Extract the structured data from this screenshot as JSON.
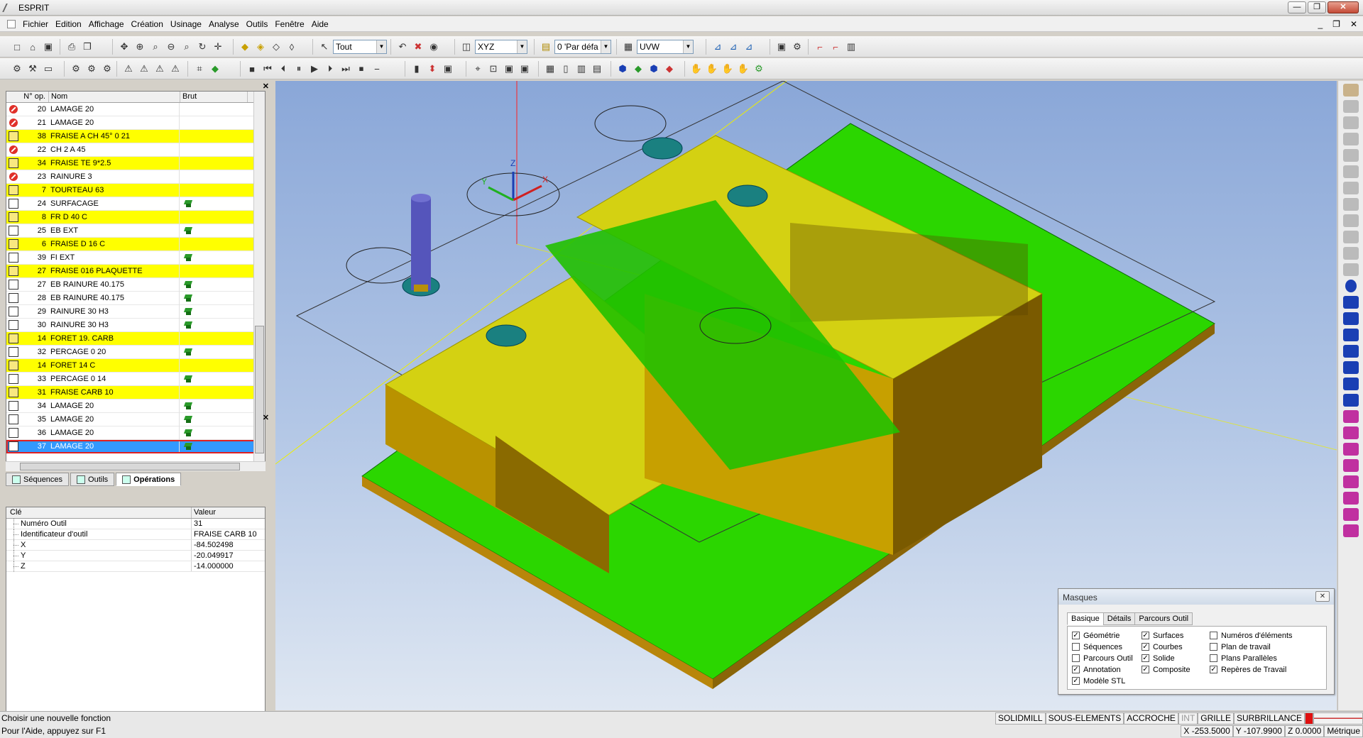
{
  "title": "ESPRIT",
  "window_buttons": {
    "minimize": "—",
    "restore": "❐",
    "close": "✕"
  },
  "menu": [
    "Fichier",
    "Edition",
    "Affichage",
    "Création",
    "Usinage",
    "Analyse",
    "Outils",
    "Fenêtre",
    "Aide"
  ],
  "mdi_buttons": {
    "minimize": "_",
    "restore": "❐",
    "close": "✕"
  },
  "toolbar": {
    "select_filter": "Tout",
    "plane": "XYZ",
    "layer": "0 'Par défa",
    "work_plane": "UVW"
  },
  "operations": {
    "headers": {
      "num": "N° op.",
      "name": "Nom",
      "brut": "Brut"
    },
    "rows": [
      {
        "icon": "forbid",
        "num": "20",
        "name": "LAMAGE 20",
        "brut": false,
        "style": "normal"
      },
      {
        "icon": "forbid",
        "num": "21",
        "name": "LAMAGE 20",
        "brut": false,
        "style": "normal"
      },
      {
        "icon": "tool",
        "num": "38",
        "name": "FRAISE A CH 45° 0 21",
        "brut": false,
        "style": "yellow"
      },
      {
        "icon": "forbid",
        "num": "22",
        "name": "CH 2 A 45",
        "brut": false,
        "style": "normal"
      },
      {
        "icon": "tool",
        "num": "34",
        "name": "FRAISE TE 9*2.5",
        "brut": false,
        "style": "yellow"
      },
      {
        "icon": "forbid",
        "num": "23",
        "name": "RAINURE 3",
        "brut": false,
        "style": "normal"
      },
      {
        "icon": "tool",
        "num": "7",
        "name": "TOURTEAU 63",
        "brut": false,
        "style": "yellow"
      },
      {
        "icon": "op",
        "num": "24",
        "name": "SURFACAGE",
        "brut": true,
        "style": "normal"
      },
      {
        "icon": "tool",
        "num": "8",
        "name": "FR D 40 C",
        "brut": false,
        "style": "yellow"
      },
      {
        "icon": "op",
        "num": "25",
        "name": "EB EXT",
        "brut": true,
        "style": "normal"
      },
      {
        "icon": "tool",
        "num": "6",
        "name": "FRAISE D 16 C",
        "brut": false,
        "style": "yellow"
      },
      {
        "icon": "op",
        "num": "39",
        "name": "FI EXT",
        "brut": true,
        "style": "normal"
      },
      {
        "icon": "tool",
        "num": "27",
        "name": "FRAISE 016 PLAQUETTE",
        "brut": false,
        "style": "yellow"
      },
      {
        "icon": "op",
        "num": "27",
        "name": "EB RAINURE 40.175",
        "brut": true,
        "style": "normal"
      },
      {
        "icon": "op",
        "num": "28",
        "name": "EB RAINURE 40.175",
        "brut": true,
        "style": "normal"
      },
      {
        "icon": "op",
        "num": "29",
        "name": " RAINURE 30 H3",
        "brut": true,
        "style": "normal"
      },
      {
        "icon": "op",
        "num": "30",
        "name": " RAINURE 30 H3",
        "brut": true,
        "style": "normal"
      },
      {
        "icon": "tool",
        "num": "14",
        "name": "FORET 19. CARB",
        "brut": false,
        "style": "yellow"
      },
      {
        "icon": "op",
        "num": "32",
        "name": "PERCAGE 0 20",
        "brut": true,
        "style": "normal"
      },
      {
        "icon": "tool",
        "num": "14",
        "name": "FORET 14 C",
        "brut": false,
        "style": "yellow"
      },
      {
        "icon": "op",
        "num": "33",
        "name": "PERCAGE 0 14",
        "brut": true,
        "style": "normal"
      },
      {
        "icon": "tool",
        "num": "31",
        "name": "FRAISE CARB 10",
        "brut": false,
        "style": "yellow"
      },
      {
        "icon": "op",
        "num": "34",
        "name": "LAMAGE 20",
        "brut": true,
        "style": "normal"
      },
      {
        "icon": "op",
        "num": "35",
        "name": "LAMAGE 20",
        "brut": true,
        "style": "normal"
      },
      {
        "icon": "op",
        "num": "36",
        "name": "LAMAGE 20",
        "brut": true,
        "style": "normal"
      },
      {
        "icon": "op",
        "num": "37",
        "name": "LAMAGE 20",
        "brut": true,
        "style": "selected"
      }
    ]
  },
  "tabs": [
    "Séquences",
    "Outils",
    "Opérations"
  ],
  "properties": {
    "headers": {
      "key": "Clé",
      "value": "Valeur"
    },
    "rows": [
      {
        "key": "Numéro Outil",
        "value": "31"
      },
      {
        "key": "Identificateur d'outil",
        "value": "FRAISE CARB 10"
      },
      {
        "key": "X",
        "value": "-84.502498"
      },
      {
        "key": "Y",
        "value": "-20.049917"
      },
      {
        "key": "Z",
        "value": "-14.000000"
      }
    ]
  },
  "axes": {
    "x": "X",
    "y": "Y",
    "z": "Z"
  },
  "masques": {
    "title": "Masques",
    "close": "✕",
    "tabs": [
      "Basique",
      "Détails",
      "Parcours Outil"
    ],
    "col1": [
      {
        "label": "Géométrie",
        "checked": true
      },
      {
        "label": "Séquences",
        "checked": false
      },
      {
        "label": "Parcours Outil",
        "checked": false
      },
      {
        "label": "Annotation",
        "checked": true
      },
      {
        "label": "Modèle STL",
        "checked": true
      }
    ],
    "col2": [
      {
        "label": "Surfaces",
        "checked": true
      },
      {
        "label": "Courbes",
        "checked": true
      },
      {
        "label": "Solide",
        "checked": true
      },
      {
        "label": "Composite",
        "checked": true
      }
    ],
    "col3": [
      {
        "label": "Numéros d'éléments",
        "checked": false
      },
      {
        "label": "Plan de travail",
        "checked": false
      },
      {
        "label": "Plans Parallèles",
        "checked": false
      },
      {
        "label": "Repères de Travail",
        "checked": true
      }
    ]
  },
  "status": {
    "line1": "Choisir une nouvelle fonction",
    "line2": "Pour l'Aide, appuyez sur F1",
    "indicators": [
      "SOLIDMILL",
      "SOUS-ELEMENTS",
      "ACCROCHE",
      "INT",
      "GRILLE",
      "SURBRILLANCE"
    ],
    "coords": {
      "x": "X -253.5000",
      "y": "Y -107.9900",
      "z": "Z 0.0000",
      "units": "Métrique"
    }
  },
  "colors": {
    "accent": "#3399ff",
    "yellow_row": "#ffff00",
    "part_green": "#22dd00",
    "part_yellow": "#d8d412"
  }
}
